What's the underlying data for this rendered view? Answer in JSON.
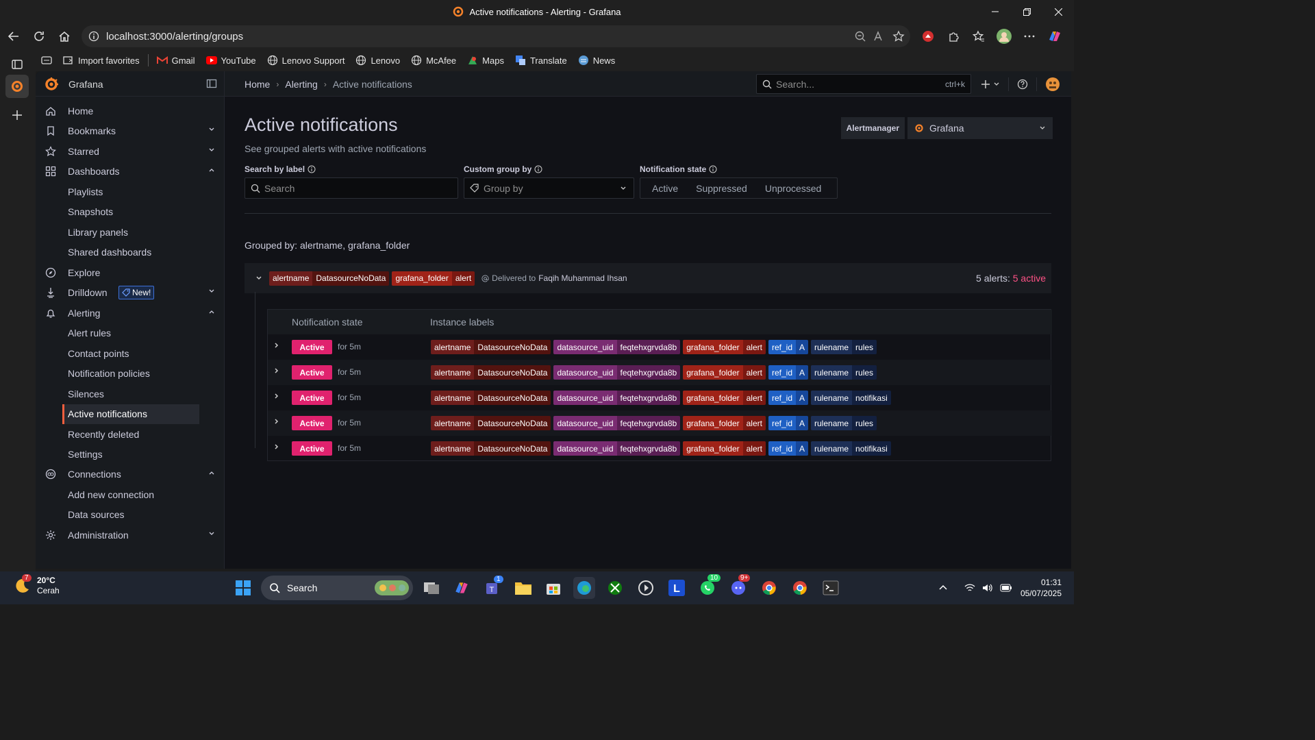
{
  "window": {
    "title": "Active notifications - Alerting - Grafana"
  },
  "browser": {
    "url": "localhost:3000/alerting/groups",
    "bookmarks": [
      "Import favorites",
      "Gmail",
      "YouTube",
      "Lenovo Support",
      "Lenovo",
      "McAfee",
      "Maps",
      "Translate",
      "News"
    ]
  },
  "topbar": {
    "brand": "Grafana",
    "breadcrumbs": [
      "Home",
      "Alerting",
      "Active notifications"
    ],
    "search_placeholder": "Search...",
    "search_shortcut": "ctrl+k"
  },
  "sidebar": {
    "items": [
      {
        "label": "Home"
      },
      {
        "label": "Bookmarks"
      },
      {
        "label": "Starred"
      },
      {
        "label": "Dashboards"
      },
      {
        "label": "Playlists"
      },
      {
        "label": "Snapshots"
      },
      {
        "label": "Library panels"
      },
      {
        "label": "Shared dashboards"
      },
      {
        "label": "Explore"
      },
      {
        "label": "Drilldown",
        "badge": "New!"
      },
      {
        "label": "Alerting"
      },
      {
        "label": "Alert rules"
      },
      {
        "label": "Contact points"
      },
      {
        "label": "Notification policies"
      },
      {
        "label": "Silences"
      },
      {
        "label": "Active notifications"
      },
      {
        "label": "Recently deleted"
      },
      {
        "label": "Settings"
      },
      {
        "label": "Connections"
      },
      {
        "label": "Add new connection"
      },
      {
        "label": "Data sources"
      },
      {
        "label": "Administration"
      }
    ]
  },
  "page": {
    "title": "Active notifications",
    "subtitle": "See grouped alerts with active notifications",
    "alertmanager_label": "Alertmanager",
    "alertmanager_value": "Grafana",
    "filters": {
      "search_label": "Search by label",
      "search_placeholder": "Search",
      "group_label": "Custom group by",
      "group_placeholder": "Group by",
      "state_label": "Notification state",
      "state_options": [
        "Active",
        "Suppressed",
        "Unprocessed"
      ]
    },
    "grouped_by": "Grouped by: alertname, grafana_folder",
    "group": {
      "tags": [
        {
          "k": "alertname",
          "v": "DatasourceNoData"
        },
        {
          "k": "grafana_folder",
          "v": "alert"
        }
      ],
      "delivered_prefix": "Delivered to",
      "delivered_to": "Faqih Muhammad Ihsan",
      "alerts_count": "5 alerts:",
      "active_count": "5 active"
    },
    "table": {
      "col_state": "Notification state",
      "col_labels": "Instance labels",
      "rows": [
        {
          "state": "Active",
          "for": "for 5m",
          "rulename": "rules"
        },
        {
          "state": "Active",
          "for": "for 5m",
          "rulename": "rules"
        },
        {
          "state": "Active",
          "for": "for 5m",
          "rulename": "notifikasi"
        },
        {
          "state": "Active",
          "for": "for 5m",
          "rulename": "rules"
        },
        {
          "state": "Active",
          "for": "for 5m",
          "rulename": "notifikasi"
        }
      ],
      "common_labels": {
        "alertname_k": "alertname",
        "alertname_v": "DatasourceNoData",
        "ds_k": "datasource_uid",
        "ds_v": "feqtehxgrvda8b",
        "folder_k": "grafana_folder",
        "folder_v": "alert",
        "ref_k": "ref_id",
        "ref_v": "A",
        "rule_k": "rulename"
      }
    }
  },
  "taskbar": {
    "temperature": "20°C",
    "weather": "Cerah",
    "weather_badge": "7",
    "search": "Search",
    "time": "01:31",
    "date": "05/07/2025",
    "teams_badge": "1",
    "whatsapp_badge": "10",
    "discord_badge": "9+"
  },
  "colors": {
    "accent": "#f55f3e",
    "active": "#e0226e",
    "active_text": "#ff5286"
  }
}
